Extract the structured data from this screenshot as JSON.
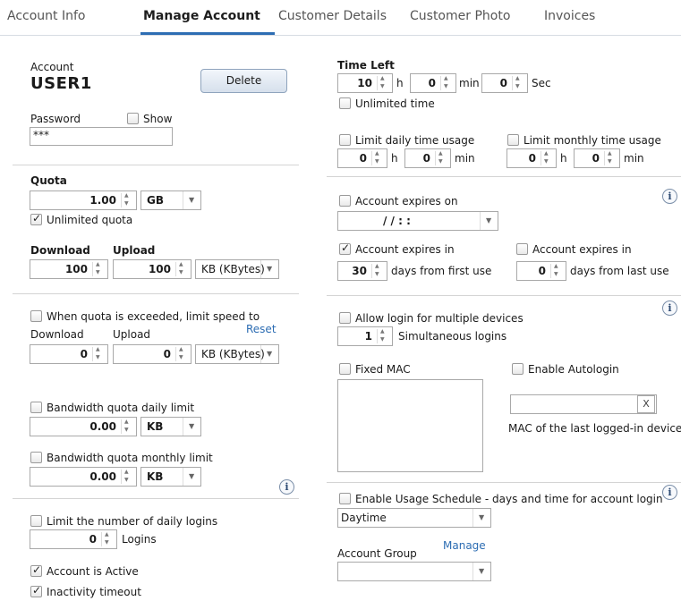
{
  "tabs": [
    "Account Info",
    "Manage Account",
    "Customer Details",
    "Customer Photo",
    "Invoices"
  ],
  "account": {
    "label": "Account",
    "name": "USER1",
    "delete_label": "Delete",
    "password_label": "Password",
    "show_label": "Show",
    "password_value": "***"
  },
  "quota": {
    "title": "Quota",
    "value": "1.00",
    "unit": "GB",
    "unlimited_label": "Unlimited quota",
    "download_label": "Download",
    "upload_label": "Upload",
    "download_value": "100",
    "upload_value": "100",
    "rate_unit": "KB (KBytes)"
  },
  "speed_limit": {
    "label": "When quota is exceeded, limit speed to",
    "download_label": "Download",
    "upload_label": "Upload",
    "reset_label": "Reset",
    "download_value": "0",
    "upload_value": "0",
    "rate_unit": "KB (KBytes)"
  },
  "bandwidth": {
    "daily_label": "Bandwidth quota daily limit",
    "daily_value": "0.00",
    "daily_unit": "KB",
    "monthly_label": "Bandwidth quota monthly limit",
    "monthly_value": "0.00",
    "monthly_unit": "KB"
  },
  "logins": {
    "limit_label": "Limit the number of daily logins",
    "value": "0",
    "unit": "Logins",
    "active_label": "Account is Active",
    "inactivity_label": "Inactivity timeout"
  },
  "time_left": {
    "title": "Time Left",
    "hours": "10",
    "h": "h",
    "minutes": "0",
    "min": "min",
    "seconds": "0",
    "sec": "Sec",
    "unlimited_label": "Unlimited time",
    "daily_label": "Limit daily time usage",
    "daily_h": "0",
    "daily_min": "0",
    "monthly_label": "Limit monthly time usage",
    "monthly_h": "0",
    "monthly_min": "0"
  },
  "expiry": {
    "expires_on_label": "Account expires on",
    "date_value": "/ /    : :",
    "expires_in_first_label": "Account expires in",
    "first_value": "30",
    "first_unit": "days from first use",
    "expires_in_last_label": "Account expires in",
    "last_value": "0",
    "last_unit": "days from last use"
  },
  "devices": {
    "multi_label": "Allow login for multiple devices",
    "simultaneous_value": "1",
    "simultaneous_label": "Simultaneous logins",
    "fixed_mac_label": "Fixed MAC",
    "autologin_label": "Enable Autologin",
    "x_label": "X",
    "mac_caption": "MAC of the last logged-in device"
  },
  "schedule": {
    "label": "Enable Usage Schedule - days and time for account login",
    "selected": "Daytime",
    "group_label": "Account Group",
    "manage_label": "Manage",
    "group_selected": ""
  },
  "info_glyph": "i",
  "colors": {
    "accent": "#2d6db3",
    "border": "#a9a9a9",
    "divider": "#d4d4d4"
  }
}
